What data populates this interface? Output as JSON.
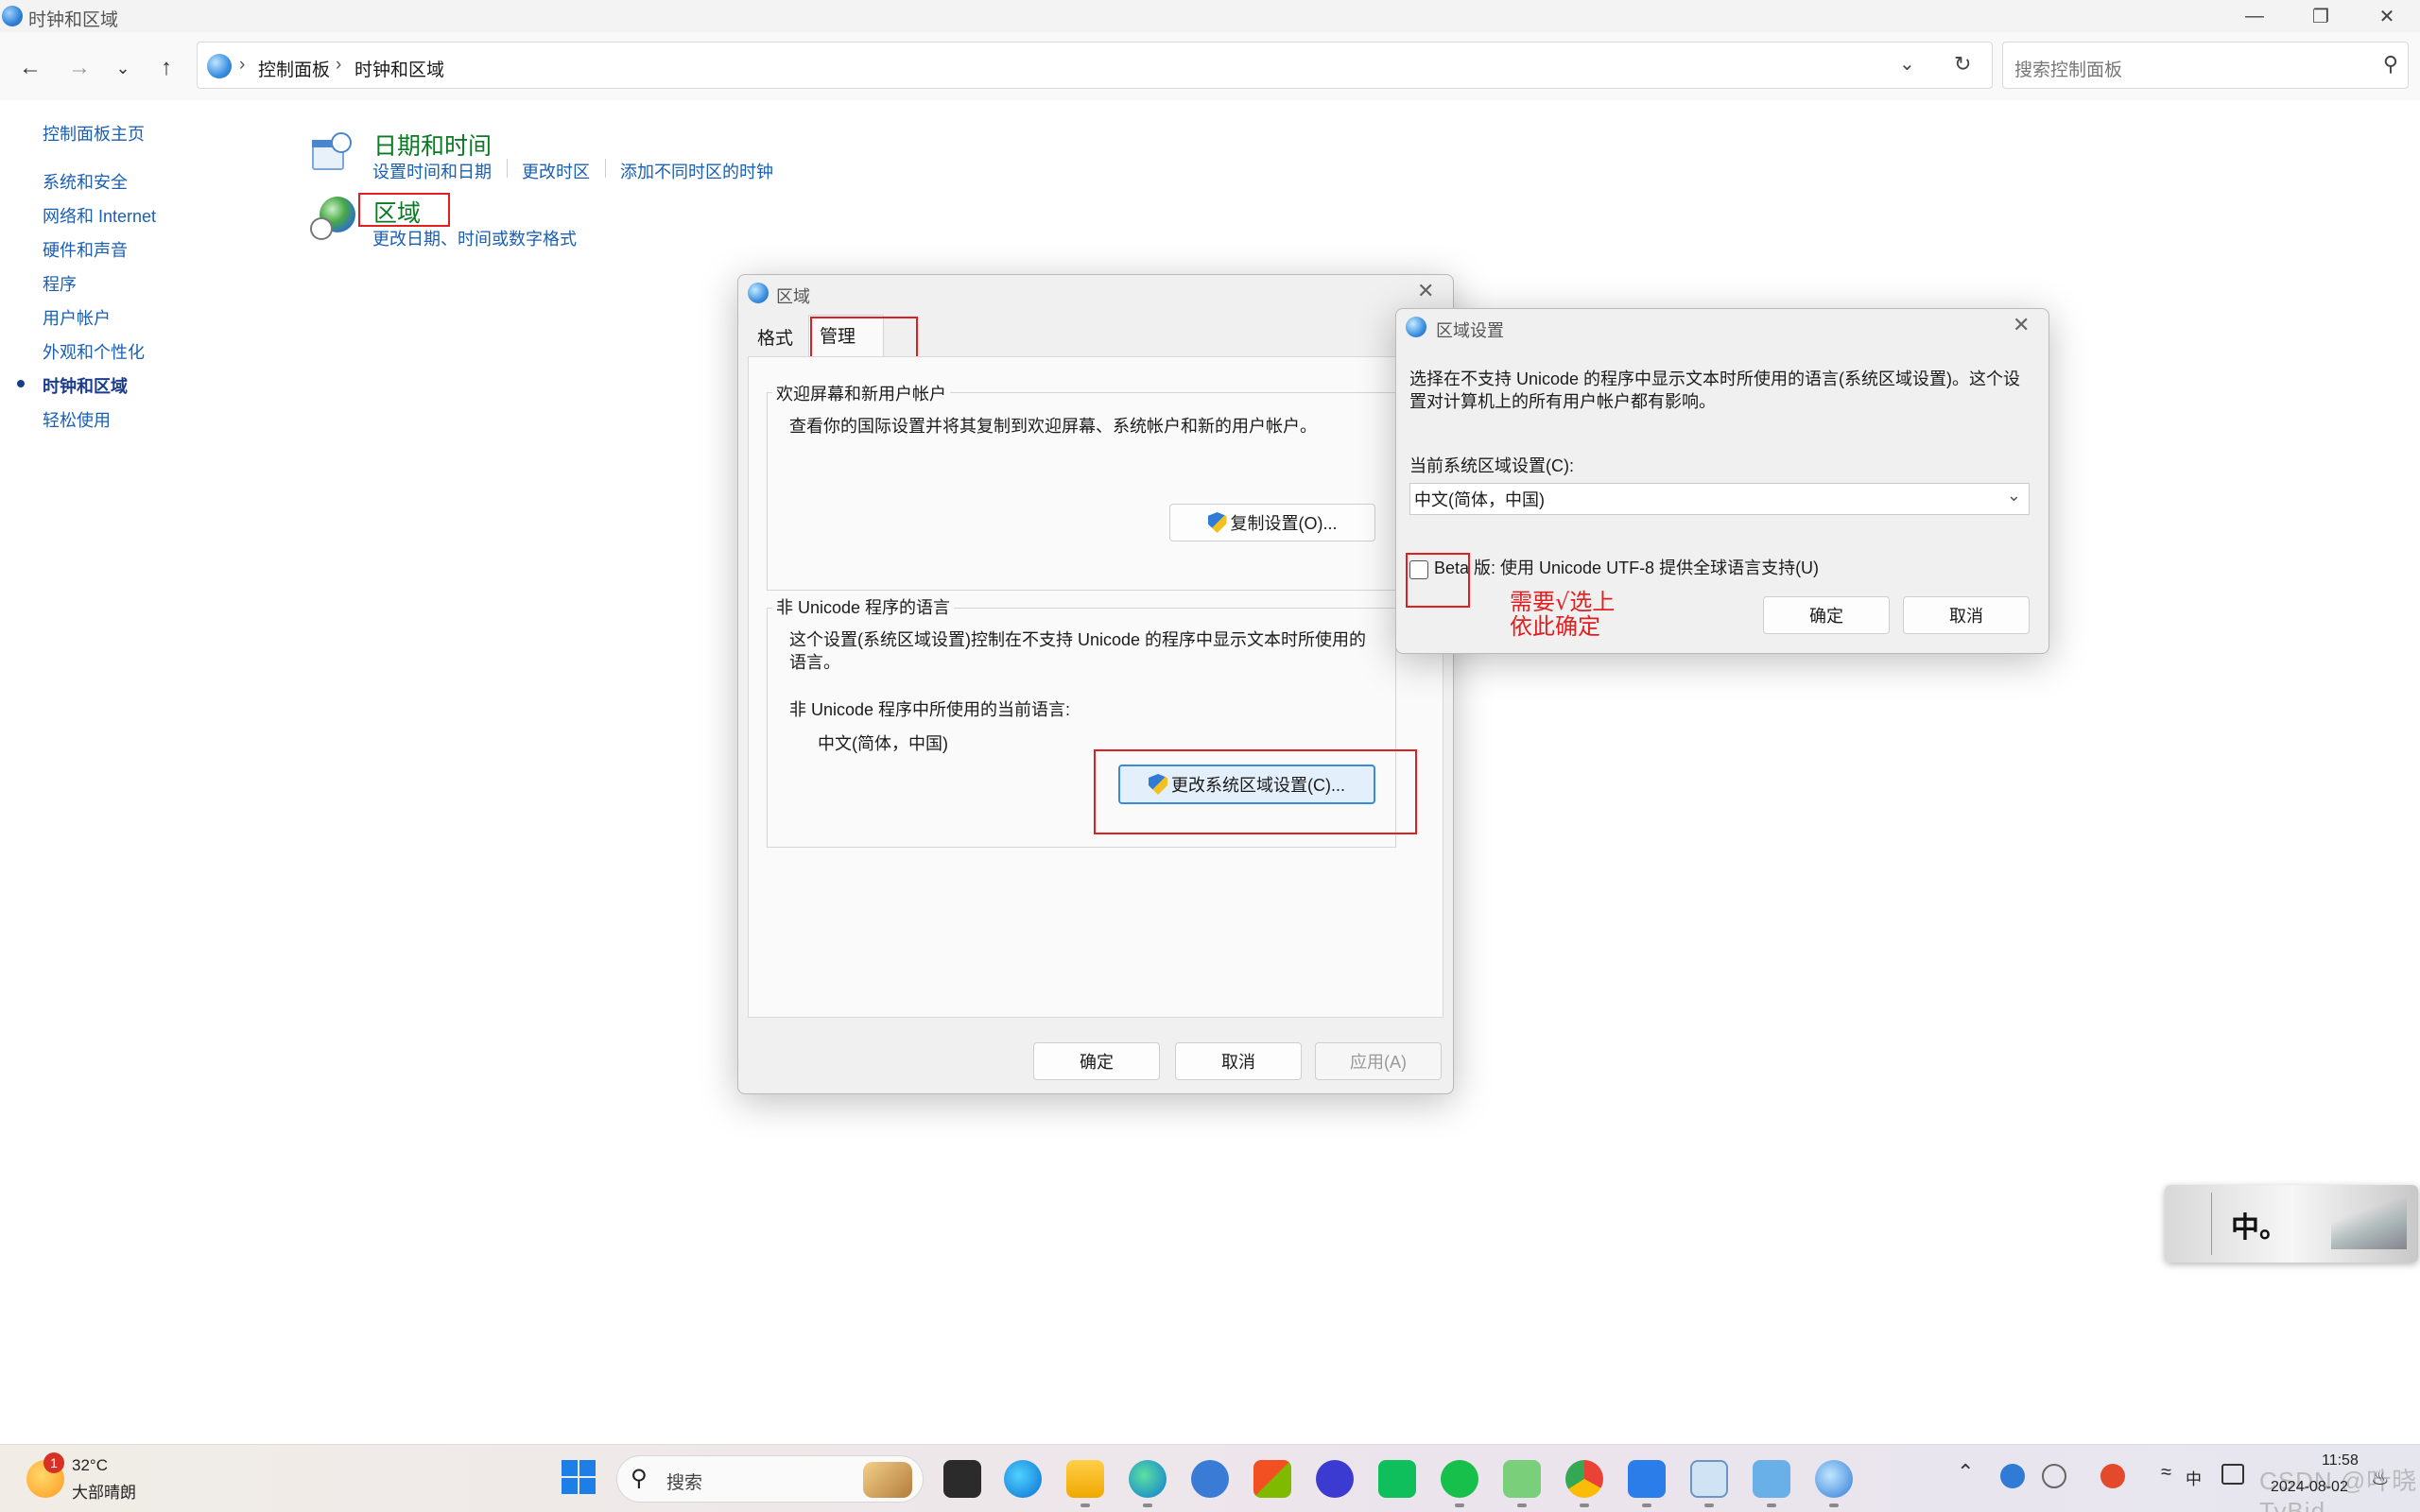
{
  "window": {
    "title": "时钟和区域"
  },
  "nav": {
    "breadcrumbs": [
      "控制面板",
      "时钟和区域"
    ],
    "search_placeholder": "搜索控制面板"
  },
  "sidebar": {
    "home": "控制面板主页",
    "items": [
      {
        "label": "系统和安全"
      },
      {
        "label": "网络和 Internet"
      },
      {
        "label": "硬件和声音"
      },
      {
        "label": "程序"
      },
      {
        "label": "用户帐户"
      },
      {
        "label": "外观和个性化"
      },
      {
        "label": "时钟和区域",
        "active": true
      },
      {
        "label": "轻松使用"
      }
    ]
  },
  "main": {
    "datetime": {
      "title": "日期和时间",
      "links": [
        "设置时间和日期",
        "更改时区",
        "添加不同时区的时钟"
      ]
    },
    "region": {
      "title": "区域",
      "link": "更改日期、时间或数字格式"
    }
  },
  "region_dialog": {
    "title": "区域",
    "tabs": [
      "格式",
      "管理"
    ],
    "active_tab": "管理",
    "welcome_group": {
      "title": "欢迎屏幕和新用户帐户",
      "text": "查看你的国际设置并将其复制到欢迎屏幕、系统帐户和新的用户帐户。",
      "button": "复制设置(O)..."
    },
    "unicode_group": {
      "title": "非 Unicode 程序的语言",
      "text_line1": "这个设置(系统区域设置)控制在不支持 Unicode 的程序中显示文本时所使用的",
      "text_line2": "语言。",
      "current_label": "非 Unicode 程序中所使用的当前语言:",
      "current_value": "中文(简体，中国)",
      "button": "更改系统区域设置(C)..."
    },
    "buttons": {
      "ok": "确定",
      "cancel": "取消",
      "apply": "应用(A)"
    }
  },
  "locale_dialog": {
    "title": "区域设置",
    "desc_line1": "选择在不支持 Unicode 的程序中显示文本时所使用的语言(系统区域设置)。这个设",
    "desc_line2": "置对计算机上的所有用户帐户都有影响。",
    "current_label": "当前系统区域设置(C):",
    "current_value": "中文(简体，中国)",
    "beta_label": "Beta 版: 使用 Unicode UTF-8 提供全球语言支持(U)",
    "beta_checked": false,
    "buttons": {
      "ok": "确定",
      "cancel": "取消"
    }
  },
  "annotation": {
    "line1": "需要√选上",
    "line2": "依此确定"
  },
  "taskbar": {
    "weather": {
      "temp": "32°C",
      "desc": "大部晴朗",
      "badge": "1"
    },
    "search_placeholder": "搜索",
    "tray": {
      "time": "11:58",
      "date": "2024-08-02",
      "ime": "中"
    },
    "watermark": "CSDN @叶晓TyBid"
  },
  "widget": {
    "text": "中。"
  }
}
